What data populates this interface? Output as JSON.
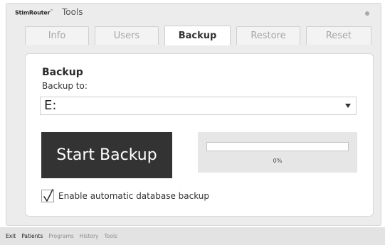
{
  "window": {
    "brand": "StimRouter",
    "brand_mark": "™",
    "title": "Tools"
  },
  "tabs": [
    {
      "label": "Info",
      "active": false
    },
    {
      "label": "Users",
      "active": false
    },
    {
      "label": "Backup",
      "active": true
    },
    {
      "label": "Restore",
      "active": false
    },
    {
      "label": "Reset",
      "active": false
    }
  ],
  "backup": {
    "title": "Backup",
    "backup_to_label": "Backup to:",
    "drive_value": "E:",
    "start_button_label": "Start Backup",
    "progress_percent": 0,
    "progress_text": "0%",
    "auto_backup_label": "Enable automatic database backup",
    "auto_backup_checked": true
  },
  "footer": {
    "nav": [
      "Exit",
      "Patients",
      "Programs",
      "History",
      "Tools"
    ]
  },
  "colors": {
    "start_button_bg": "#333333",
    "progress_box_bg": "#e6e6e6",
    "window_bg": "#ececec"
  }
}
